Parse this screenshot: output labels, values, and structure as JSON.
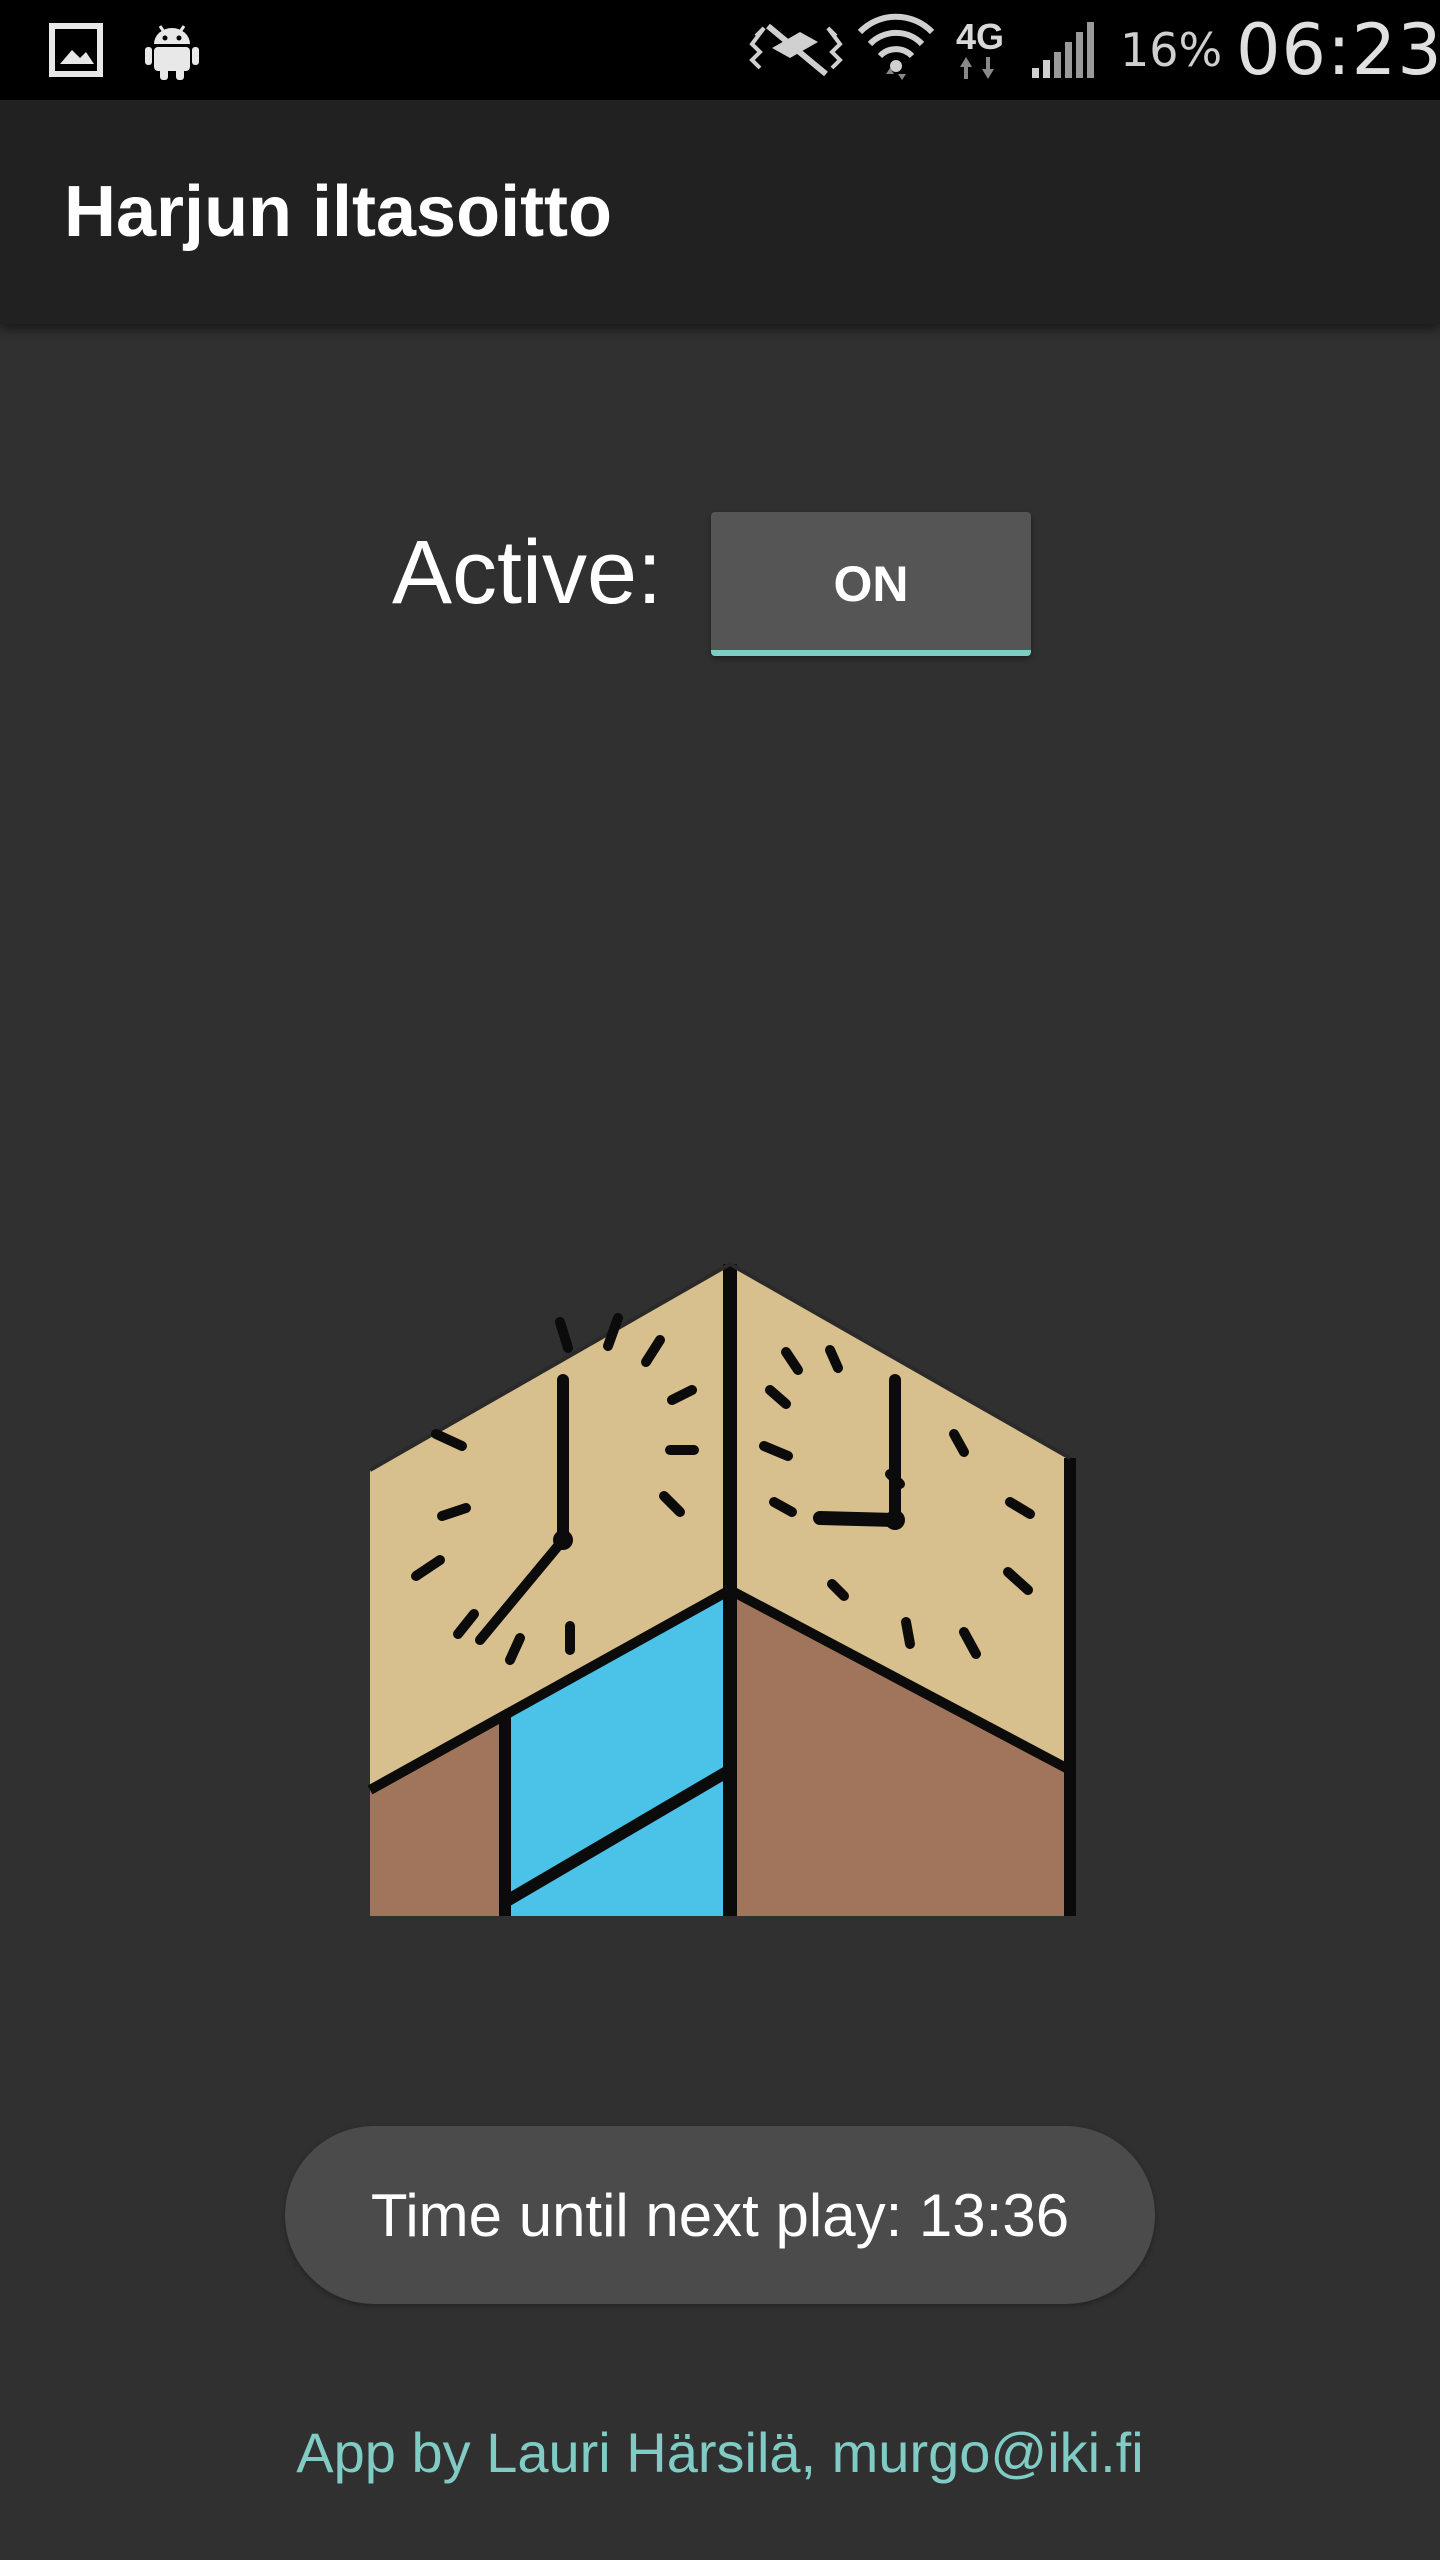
{
  "status_bar": {
    "icons": [
      "gallery-icon",
      "android-icon",
      "vibrate-icon",
      "wifi-icon",
      "4g-icon",
      "signal-icon"
    ],
    "network_label": "4G",
    "battery": "16%",
    "time": "06:23"
  },
  "app_bar": {
    "title": "Harjun iltasoitto"
  },
  "main": {
    "active_label": "Active:",
    "toggle_label": "ON",
    "toggle_state": true,
    "accent_color": "#80cbc4"
  },
  "toast": {
    "text": "Time until next play: 13:36"
  },
  "footer": {
    "credits": "App by Lauri Härsilä, murgo@iki.fi"
  }
}
